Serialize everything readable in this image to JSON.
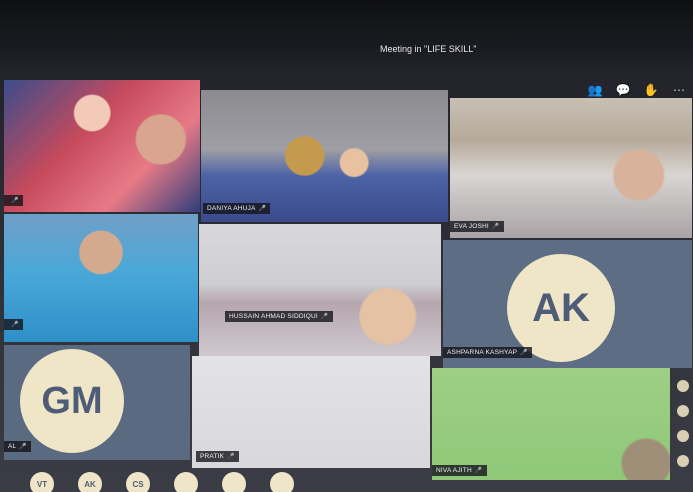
{
  "meeting": {
    "title": "Meeting in \"LIFE SKILL\""
  },
  "toolbar": {
    "icons": [
      "participants-icon",
      "chat-icon",
      "raise-hand-icon",
      "more-icon"
    ]
  },
  "tiles": [
    {
      "name": "",
      "initials": ""
    },
    {
      "name": "DANIYA AHUJA",
      "initials": ""
    },
    {
      "name": "EVA JOSHI",
      "initials": ""
    },
    {
      "name": "",
      "initials": ""
    },
    {
      "name": "HUSSAIN AHMAD SIDDIQUI",
      "initials": ""
    },
    {
      "name": "ASHPARNA KASHYAP",
      "initials": "AK"
    },
    {
      "name": "AL",
      "initials": "GM"
    },
    {
      "name": "PRATIK",
      "initials": ""
    },
    {
      "name": "NIVA AJITH",
      "initials": ""
    }
  ],
  "bottom_avatars": [
    "VT",
    "AK",
    "CS"
  ],
  "colors": {
    "avatar_bg": "#efe6c8",
    "avatar_text": "#4f5c78",
    "tile_dark": "#5d6d83"
  }
}
